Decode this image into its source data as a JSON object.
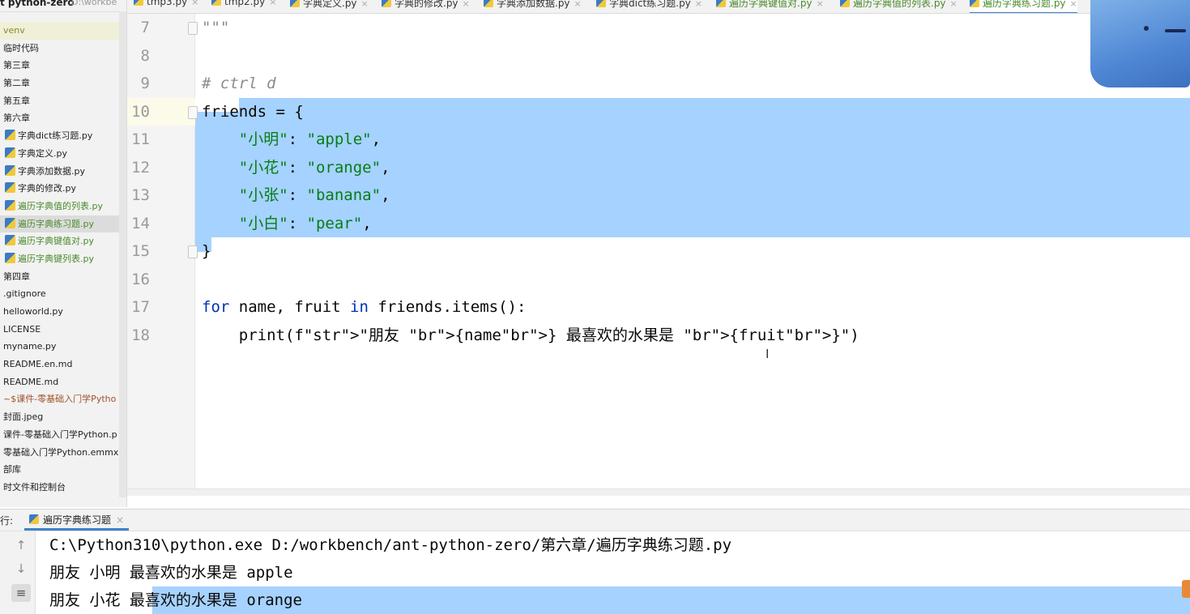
{
  "sidebar": {
    "project_title": "t python-zero",
    "project_path": "D:\\workbe",
    "items": [
      {
        "label": "venv",
        "type": "folder",
        "style": "venv"
      },
      {
        "label": "临时代码",
        "type": "folder"
      },
      {
        "label": "第三章",
        "type": "folder"
      },
      {
        "label": "第二章",
        "type": "folder"
      },
      {
        "label": "第五章",
        "type": "folder"
      },
      {
        "label": "第六章",
        "type": "folder"
      },
      {
        "label": "字典dict练习题.py",
        "type": "py"
      },
      {
        "label": "字典定义.py",
        "type": "py"
      },
      {
        "label": "字典添加数据.py",
        "type": "py"
      },
      {
        "label": "字典的修改.py",
        "type": "py"
      },
      {
        "label": "遍历字典值的列表.py",
        "type": "py",
        "style": "green"
      },
      {
        "label": "遍历字典练习题.py",
        "type": "py",
        "style": "green",
        "selected": true
      },
      {
        "label": "遍历字典键值对.py",
        "type": "py",
        "style": "green"
      },
      {
        "label": "遍历字典键列表.py",
        "type": "py",
        "style": "green"
      },
      {
        "label": "第四章",
        "type": "folder"
      },
      {
        "label": ".gitignore",
        "type": "file"
      },
      {
        "label": "helloworld.py",
        "type": "file"
      },
      {
        "label": "LICENSE",
        "type": "file"
      },
      {
        "label": "myname.py",
        "type": "file"
      },
      {
        "label": "README.en.md",
        "type": "file"
      },
      {
        "label": "README.md",
        "type": "file"
      },
      {
        "label": "~$课件-零基础入门学Pytho",
        "type": "file",
        "style": "brown"
      },
      {
        "label": "封面.jpeg",
        "type": "file"
      },
      {
        "label": "课件-零基础入门学Python.p",
        "type": "file"
      },
      {
        "label": "零基础入门学Python.emmx",
        "type": "file"
      },
      {
        "label": "部库",
        "type": "folder"
      },
      {
        "label": "时文件和控制台",
        "type": "folder"
      }
    ]
  },
  "tabs": [
    {
      "label": "tmp3.py"
    },
    {
      "label": "tmp2.py"
    },
    {
      "label": "字典定义.py"
    },
    {
      "label": "字典的修改.py"
    },
    {
      "label": "字典添加数据.py"
    },
    {
      "label": "字典dict练习题.py"
    },
    {
      "label": "遍历字典键值对.py",
      "style": "green"
    },
    {
      "label": "遍历字典值的列表.py",
      "style": "green"
    },
    {
      "label": "遍历字典练习题.py",
      "style": "green",
      "active": true
    }
  ],
  "editor": {
    "lines": [
      {
        "num": "7",
        "text": "\"\"\""
      },
      {
        "num": "8",
        "text": ""
      },
      {
        "num": "9",
        "text": "# ctrl d"
      },
      {
        "num": "10",
        "text": "friends = {"
      },
      {
        "num": "11",
        "text": "    \"小明\": \"apple\","
      },
      {
        "num": "12",
        "text": "    \"小花\": \"orange\","
      },
      {
        "num": "13",
        "text": "    \"小张\": \"banana\","
      },
      {
        "num": "14",
        "text": "    \"小白\": \"pear\","
      },
      {
        "num": "15",
        "text": "}"
      },
      {
        "num": "16",
        "text": ""
      },
      {
        "num": "17",
        "text": "for name, fruit in friends.items():"
      },
      {
        "num": "18",
        "text": "    print(f\"朋友 {name} 最喜欢的水果是 {fruit}\")"
      }
    ]
  },
  "run_panel": {
    "label": "行:",
    "tab_label": "遍历字典练习题",
    "console_lines": [
      "C:\\Python310\\python.exe D:/workbench/ant-python-zero/第六章/遍历字典练习题.py",
      "朋友 小明 最喜欢的水果是 apple",
      "朋友 小花 最喜欢的水果是 orange"
    ]
  },
  "colors": {
    "selection": "#a6d2ff",
    "keyword": "#0033b3",
    "string": "#067d17",
    "comment": "#8c8c8c",
    "tab_active_underline": "#4083c9"
  }
}
